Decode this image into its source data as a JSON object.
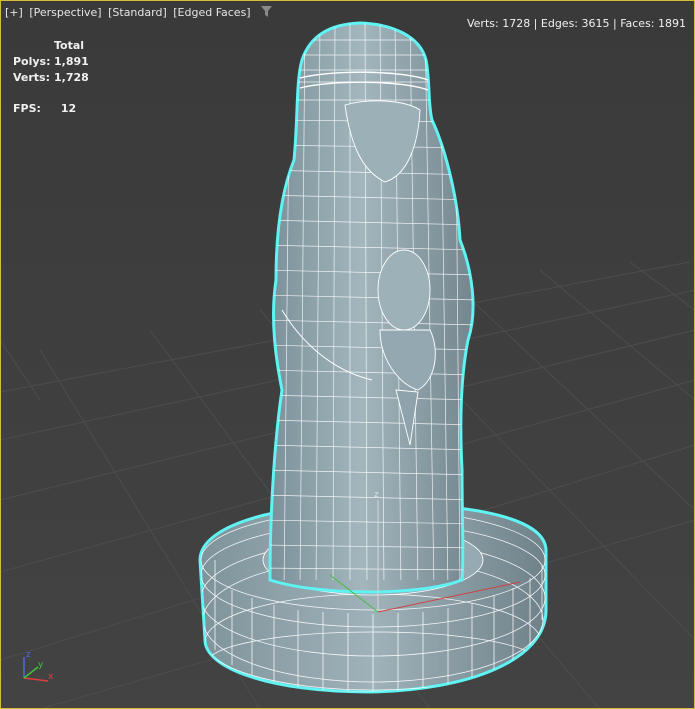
{
  "viewport": {
    "labels": [
      "[+]",
      "[Perspective]",
      "[Standard]",
      "[Edged Faces]"
    ],
    "filter_icon": "funnel-icon",
    "border_color": "#d7bb3a"
  },
  "stats_right": "Verts: 1728 | Edges: 3615 | Faces: 1891",
  "stats": {
    "header": "Total",
    "polys_label": "Polys:",
    "polys_value": "1,891",
    "verts_label": "Verts:",
    "verts_value": "1,728"
  },
  "fps": {
    "label": "FPS:",
    "value": "12"
  },
  "gizmo": {
    "z_label": "z"
  },
  "axis_tripod": {
    "x": "x",
    "y": "y",
    "z": "z"
  },
  "colors": {
    "model_fill": "#8ea4ad",
    "wire": "#ffffff",
    "selection_outline": "#5ff3f3",
    "grid": "#4b4b4b"
  }
}
